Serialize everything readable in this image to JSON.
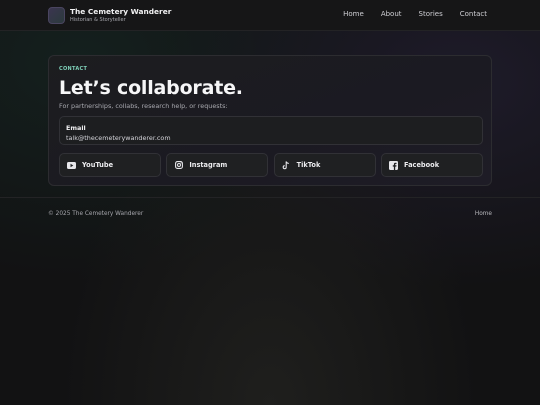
{
  "brand": {
    "title": "The Cemetery Wanderer",
    "subtitle": "Historian & Storyteller"
  },
  "nav": {
    "items": [
      "Home",
      "About",
      "Stories",
      "Contact"
    ]
  },
  "contact": {
    "eyebrow": "CONTACT",
    "headline": "Let’s collaborate.",
    "subline": "For partnerships, collabs, research help, or requests:",
    "email_label": "Email",
    "email_value": "talk@thecemeterywanderer.com"
  },
  "socials": [
    {
      "label": "YouTube",
      "icon": "youtube-icon"
    },
    {
      "label": "Instagram",
      "icon": "instagram-icon"
    },
    {
      "label": "TikTok",
      "icon": "tiktok-icon"
    },
    {
      "label": "Facebook",
      "icon": "facebook-icon"
    }
  ],
  "footer": {
    "copyright": "© 2025 The Cemetery Wanderer",
    "link": "Home"
  }
}
